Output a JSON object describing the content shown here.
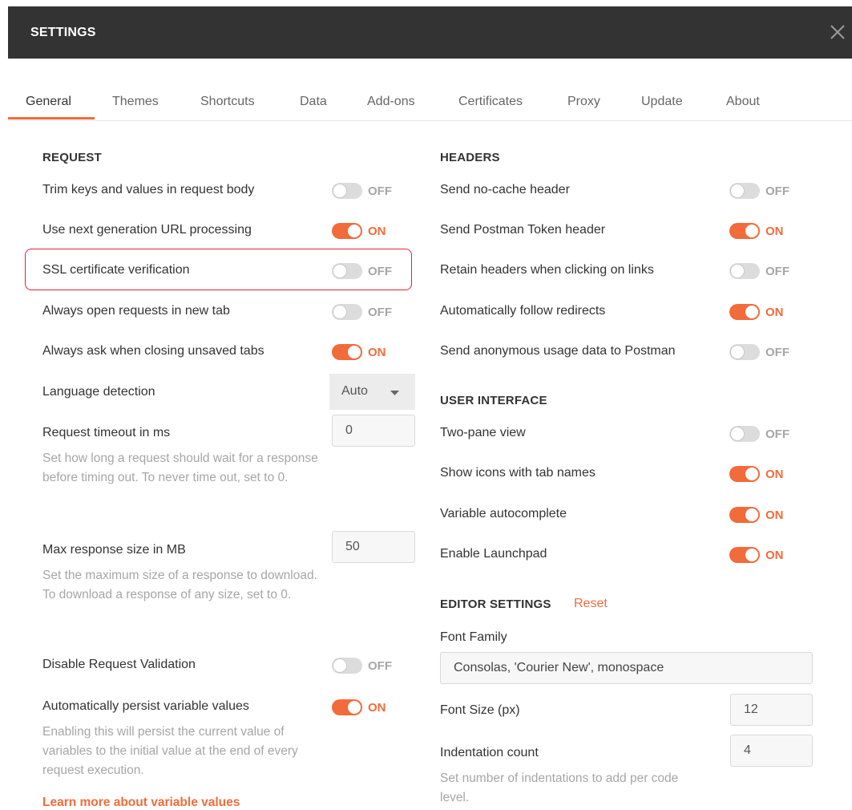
{
  "window": {
    "title": "SETTINGS"
  },
  "tabs": [
    "General",
    "Themes",
    "Shortcuts",
    "Data",
    "Add-ons",
    "Certificates",
    "Proxy",
    "Update",
    "About"
  ],
  "active_tab": "General",
  "colors": {
    "accent": "#f26b3a",
    "titlebar": "#333333",
    "highlight": "#e0262f",
    "toggle_off": "#dcdcdc"
  },
  "request": {
    "heading": "REQUEST",
    "trim_keys": {
      "label": "Trim keys and values in request body",
      "state": "OFF"
    },
    "next_gen_url": {
      "label": "Use next generation URL processing",
      "state": "ON"
    },
    "ssl_verification": {
      "label": "SSL certificate verification",
      "state": "OFF"
    },
    "open_new_tab": {
      "label": "Always open requests in new tab",
      "state": "OFF"
    },
    "ask_closing": {
      "label": "Always ask when closing unsaved tabs",
      "state": "ON"
    },
    "language_detection": {
      "label": "Language detection",
      "value": "Auto"
    },
    "timeout": {
      "label": "Request timeout in ms",
      "value": "0",
      "help": "Set how long a request should wait for a response before timing out. To never time out, set to 0."
    },
    "max_response": {
      "label": "Max response size in MB",
      "value": "50",
      "help": "Set the maximum size of a response to download. To download a response of any size, set to 0."
    },
    "disable_validation": {
      "label": "Disable Request Validation",
      "state": "OFF"
    },
    "persist_variables": {
      "label": "Automatically persist variable values",
      "state": "ON",
      "help": "Enabling this will persist the current value of variables to the initial value at the end of every request execution.",
      "link": "Learn more about variable values"
    }
  },
  "headers": {
    "heading": "HEADERS",
    "no_cache": {
      "label": "Send no-cache header",
      "state": "OFF"
    },
    "postman_token": {
      "label": "Send Postman Token header",
      "state": "ON"
    },
    "retain_headers": {
      "label": "Retain headers when clicking on links",
      "state": "OFF"
    },
    "follow_redirects": {
      "label": "Automatically follow redirects",
      "state": "ON"
    },
    "usage_data": {
      "label": "Send anonymous usage data to Postman",
      "state": "OFF"
    }
  },
  "user_interface": {
    "heading": "USER INTERFACE",
    "two_pane": {
      "label": "Two-pane view",
      "state": "OFF"
    },
    "tab_icons": {
      "label": "Show icons with tab names",
      "state": "ON"
    },
    "variable_autocomplete": {
      "label": "Variable autocomplete",
      "state": "ON"
    },
    "launchpad": {
      "label": "Enable Launchpad",
      "state": "ON"
    }
  },
  "editor": {
    "heading": "EDITOR SETTINGS",
    "reset": "Reset",
    "font_family": {
      "label": "Font Family",
      "value": "Consolas, 'Courier New', monospace"
    },
    "font_size": {
      "label": "Font Size (px)",
      "value": "12"
    },
    "indentation": {
      "label": "Indentation count",
      "value": "4",
      "help": "Set number of indentations to add per code level."
    }
  }
}
